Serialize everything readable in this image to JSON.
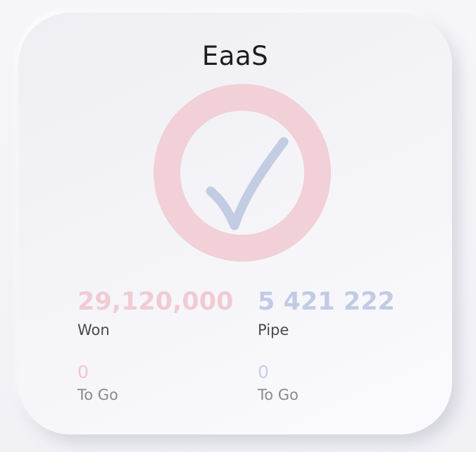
{
  "card": {
    "title": "EaaS",
    "status_icon": "checkmark-in-ring-icon",
    "colors": {
      "ring": "#f1d0d7",
      "check": "#c2cce2",
      "won_value": "#f0cbd3",
      "pipe_value": "#c1cbe3",
      "won_togo_value": "#f0c5d0",
      "pipe_togo_value": "#c5d0e6",
      "label": "#4a4a4a",
      "sub_label": "#8a8a8a"
    }
  },
  "metrics": {
    "won": {
      "value": "29,120,000",
      "label": "Won",
      "togo_value": "0",
      "togo_label": "To Go"
    },
    "pipe": {
      "value": "5 421 222",
      "label": "Pipe",
      "togo_value": "0",
      "togo_label": "To Go"
    }
  }
}
